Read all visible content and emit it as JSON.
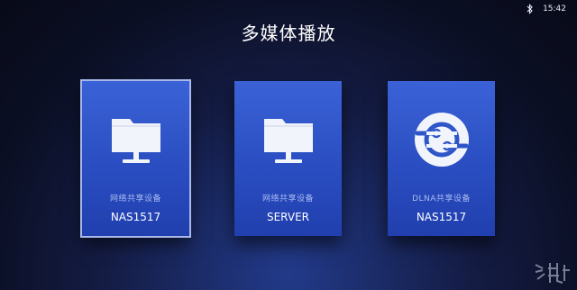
{
  "status": {
    "time": "15:42",
    "bluetooth_icon": "bluetooth-icon"
  },
  "title": "多媒体播放",
  "cards": [
    {
      "sub": "网络共享设备",
      "name": "NAS1517",
      "icon": "folder-monitor-icon",
      "selected": true
    },
    {
      "sub": "网络共享设备",
      "name": "SERVER",
      "icon": "folder-monitor-icon",
      "selected": false
    },
    {
      "sub": "DLNA共享设备",
      "name": "NAS1517",
      "icon": "dlna-icon",
      "selected": false
    }
  ],
  "colors": {
    "card_top": "#3a62d6",
    "card_bottom": "#213fae",
    "selected_outline": "#aab8e8"
  }
}
